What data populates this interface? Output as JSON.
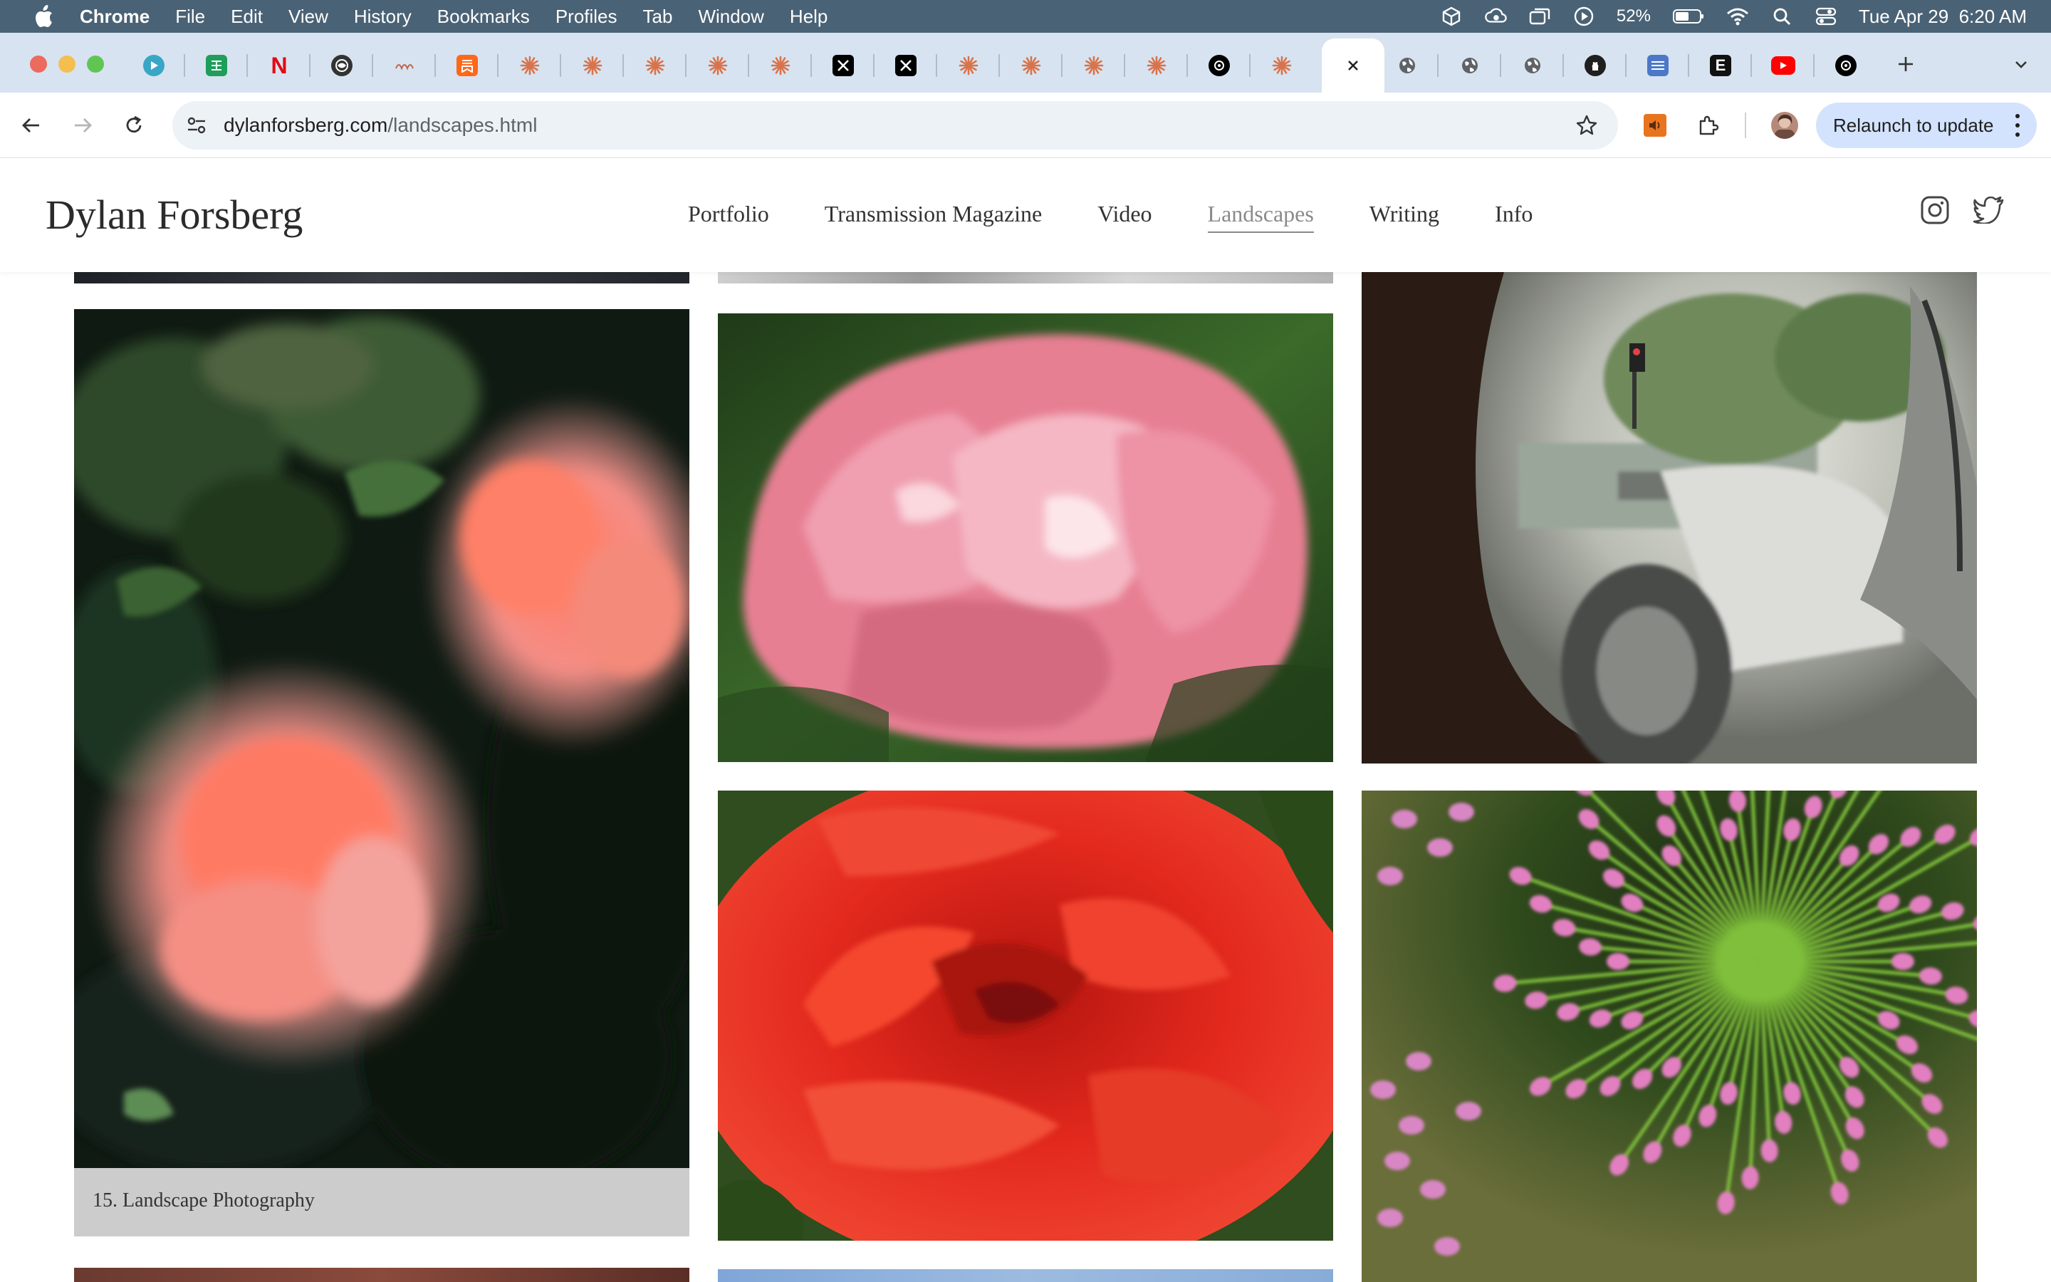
{
  "menubar": {
    "app_name": "Chrome",
    "items": [
      "File",
      "Edit",
      "View",
      "History",
      "Bookmarks",
      "Profiles",
      "Tab",
      "Window",
      "Help"
    ],
    "battery": "52%",
    "datetime": "Tue Apr 29  6:20 AM"
  },
  "tabs": {
    "favicons": [
      "play-icon",
      "sheets-icon",
      "netflix-icon",
      "app-icon",
      "squiggle-icon",
      "substack-icon",
      "claude-icon",
      "claude-icon",
      "claude-icon",
      "claude-icon",
      "claude-icon",
      "x-icon",
      "x-icon",
      "claude-icon",
      "claude-icon",
      "claude-icon",
      "claude-icon",
      "openai-icon",
      "claude-icon",
      "active-tab",
      "globe-icon",
      "globe-icon",
      "globe-icon",
      "github-icon",
      "sheet-icon",
      "e-icon",
      "youtube-icon",
      "openai-icon"
    ],
    "netflix_letter": "N",
    "e_letter": "E"
  },
  "toolbar": {
    "url_domain": "dylanforsberg.com",
    "url_path": "/landscapes.html",
    "relaunch_label": "Relaunch to update"
  },
  "site": {
    "brand": "Dylan Forsberg",
    "nav": [
      "Portfolio",
      "Transmission Magazine",
      "Video",
      "Landscapes",
      "Writing",
      "Info"
    ],
    "current_nav": "Landscapes"
  },
  "gallery": {
    "caption": "15. Landscape Photography"
  },
  "colors": {
    "menubar_bg": "#4a6275",
    "tabstrip_bg": "#d7e3f0",
    "claude_orange": "#d9734a",
    "relaunch_bg": "#d3e3fd"
  }
}
